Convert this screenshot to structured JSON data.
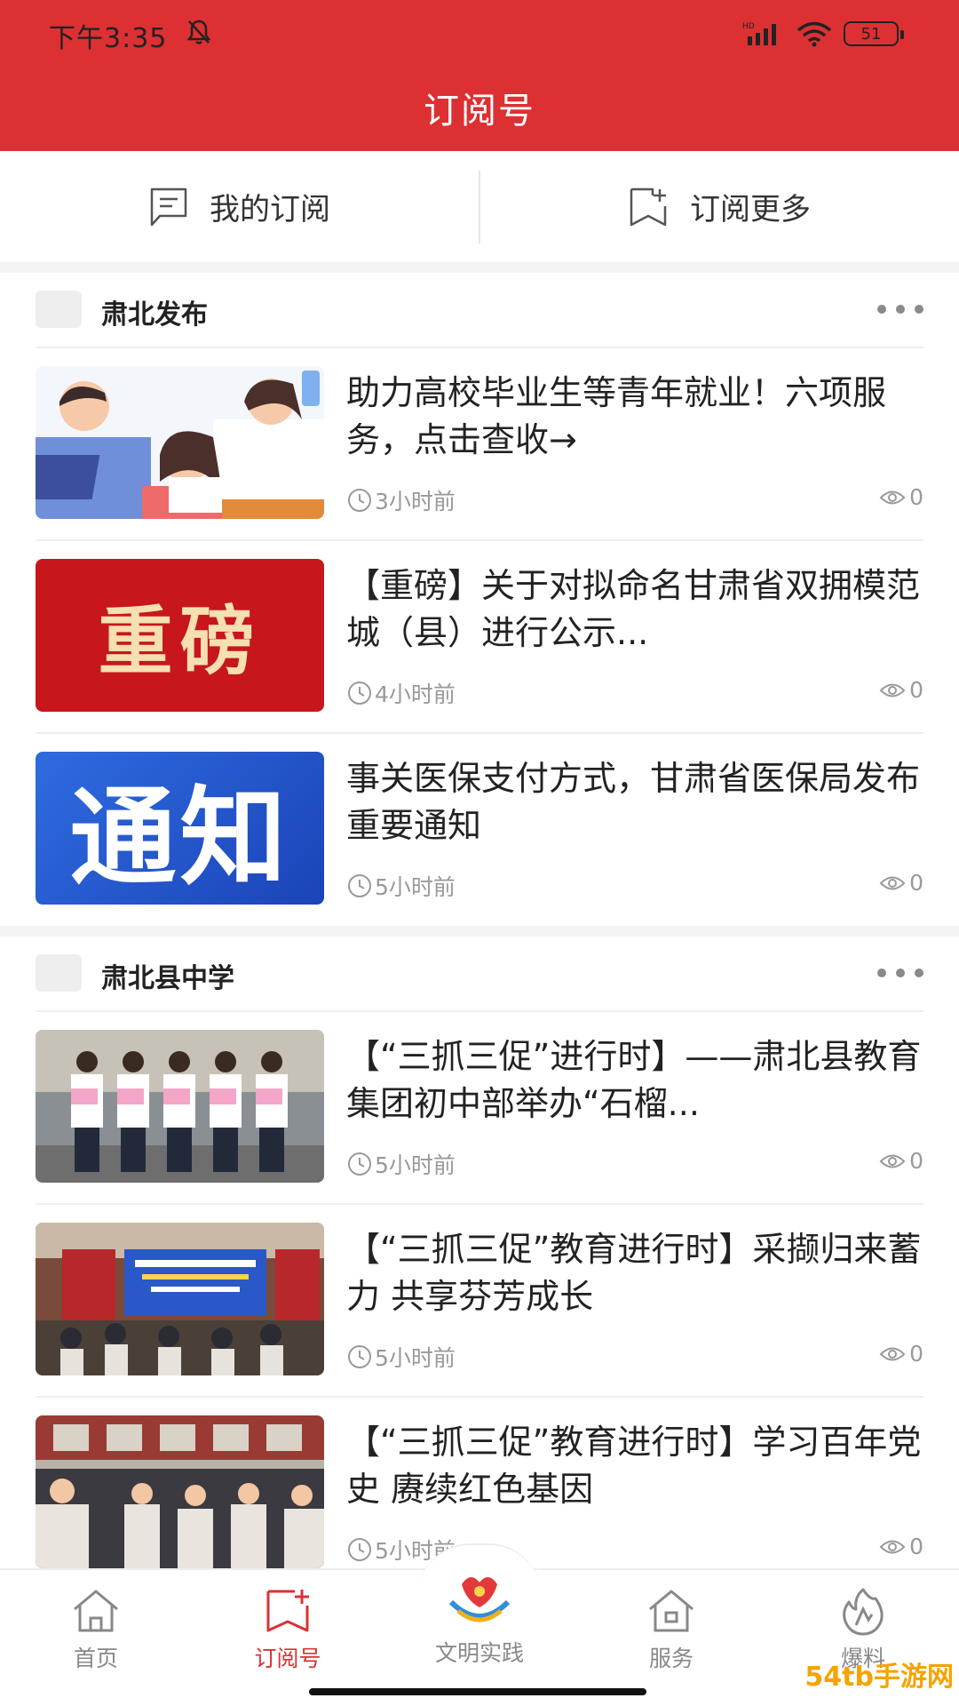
{
  "status_bar": {
    "time": "下午3:35",
    "battery": "51"
  },
  "header": {
    "title": "订阅号"
  },
  "switcher": {
    "my_subscriptions": "我的订阅",
    "subscribe_more": "订阅更多"
  },
  "sections": [
    {
      "name": "肃北发布",
      "articles": [
        {
          "title": "助力高校毕业生等青年就业！六项服务，点击查收→",
          "time": "3小时前",
          "views": "0"
        },
        {
          "title": "【重磅】关于对拟命名甘肃省双拥模范城（县）进行公示...",
          "time": "4小时前",
          "views": "0",
          "thumb_text": "重磅"
        },
        {
          "title": "事关医保支付方式，甘肃省医保局发布重要通知",
          "time": "5小时前",
          "views": "0",
          "thumb_text": "通知"
        }
      ]
    },
    {
      "name": "肃北县中学",
      "articles": [
        {
          "title": "【“三抓三促”进行时】——肃北县教育集团初中部举办“石榴...",
          "time": "5小时前",
          "views": "0"
        },
        {
          "title": "【“三抓三促”教育进行时】采撷归来蓄力 共享芬芳成长",
          "time": "5小时前",
          "views": "0"
        },
        {
          "title": "【“三抓三促”教育进行时】学习百年党史 赓续红色基因",
          "time": "5小时前",
          "views": "0"
        }
      ]
    }
  ],
  "bottom_nav": {
    "home": "首页",
    "subscriptions": "订阅号",
    "civilization": "文明实践",
    "services": "服务",
    "tips": "爆料"
  },
  "watermark": "54tb手游网",
  "colors": {
    "brand_red": "#dd3033",
    "meta_gray": "#999999"
  }
}
